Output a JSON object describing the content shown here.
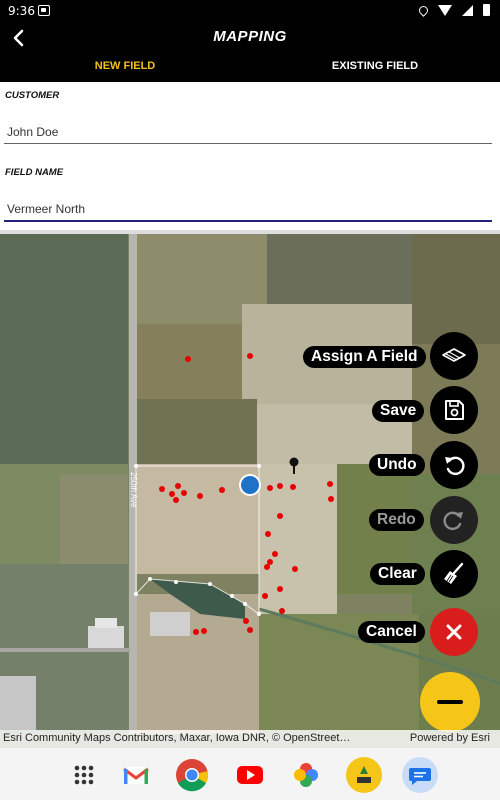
{
  "status_bar": {
    "time": "9:36"
  },
  "header": {
    "title": "MAPPING",
    "back_icon": "arrow-left-icon"
  },
  "tabs": [
    {
      "label": "NEW FIELD",
      "active": true,
      "color": "#f3c01c"
    },
    {
      "label": "EXISTING FIELD",
      "active": false
    }
  ],
  "form": {
    "customer": {
      "label": "CUSTOMER",
      "value": "John Doe"
    },
    "field_name": {
      "label": "FIELD NAME",
      "value": "Vermeer North"
    }
  },
  "map": {
    "road_label": "250th Ave",
    "attribution": "Esri Community Maps Contributors, Maxar, Iowa DNR, © OpenStreet…",
    "powered_by": "Powered by Esri"
  },
  "actions": [
    {
      "label": "Assign A Field",
      "icon": "layers-icon",
      "enabled": true
    },
    {
      "label": "Save",
      "icon": "save-icon",
      "enabled": true
    },
    {
      "label": "Undo",
      "icon": "undo-icon",
      "enabled": true
    },
    {
      "label": "Redo",
      "icon": "redo-icon",
      "enabled": false
    },
    {
      "label": "Clear",
      "icon": "broom-icon",
      "enabled": true
    },
    {
      "label": "Cancel",
      "icon": "close-icon",
      "enabled": true,
      "color": "#d91d1d"
    }
  ],
  "fab": {
    "icon": "minus-icon",
    "color": "#f5c518"
  },
  "dock": [
    "apps-grid-icon",
    "gmail-icon",
    "chrome-icon",
    "youtube-icon",
    "photos-icon",
    "vermeer-app-icon",
    "messages-icon"
  ]
}
